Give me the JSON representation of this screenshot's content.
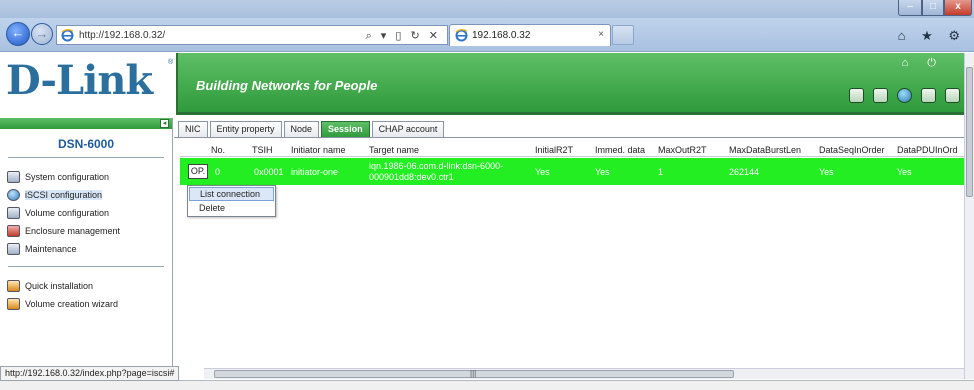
{
  "browser": {
    "url": "http://192.168.0.32/",
    "tab_title": "192.168.0.32",
    "search_tools": "⌕ ▾ ▯ ↻ ✕",
    "tab_close": "×",
    "chrome_icons": "⌂ ★ ⚙",
    "window_controls": {
      "minimize": "–",
      "maximize": "□",
      "close": "x"
    }
  },
  "header": {
    "logo": "D-Link",
    "logo_reg": "®",
    "tagline": "Building Networks for People",
    "top_icons": "⌂ ⏻"
  },
  "sidebar": {
    "collapse": "◂",
    "device": "DSN-6000",
    "items": [
      {
        "label": "System configuration"
      },
      {
        "label": "iSCSI configuration"
      },
      {
        "label": "Volume configuration"
      },
      {
        "label": "Enclosure management"
      },
      {
        "label": "Maintenance"
      }
    ],
    "wizards": [
      {
        "label": "Quick installation"
      },
      {
        "label": "Volume creation wizard"
      }
    ]
  },
  "tabs": [
    "NIC",
    "Entity property",
    "Node",
    "Session",
    "CHAP account"
  ],
  "active_tab": "Session",
  "table": {
    "columns": [
      "No.",
      "TSIH",
      "Initiator name",
      "Target name",
      "InitialR2T",
      "Immed. data",
      "MaxOutR2T",
      "MaxDataBurstLen",
      "DataSeqInOrder",
      "DataPDUInOrd"
    ],
    "rows": [
      {
        "op": "OP.",
        "no": "0",
        "tsih": "0x0001",
        "initiator": "initiator-one",
        "target_line1": "iqn.1986-06.com.d-link:dsn-6000-",
        "target_line2": "000901dd8:dev0.ctr1",
        "initial_r2t": "Yes",
        "immed_data": "Yes",
        "max_out_r2t": "1",
        "max_data_burst_len": "262144",
        "data_seq_in_order": "Yes",
        "data_pdu_in_order": "Yes"
      }
    ]
  },
  "op_menu": [
    "List connection",
    "Delete"
  ],
  "status": {
    "url": "http://192.168.0.32/index.php?page=iscsi#"
  },
  "colors": {
    "row_bg": "#22ee22",
    "header_green": "#2f9a3c",
    "logo_blue": "#2a6f9d"
  }
}
